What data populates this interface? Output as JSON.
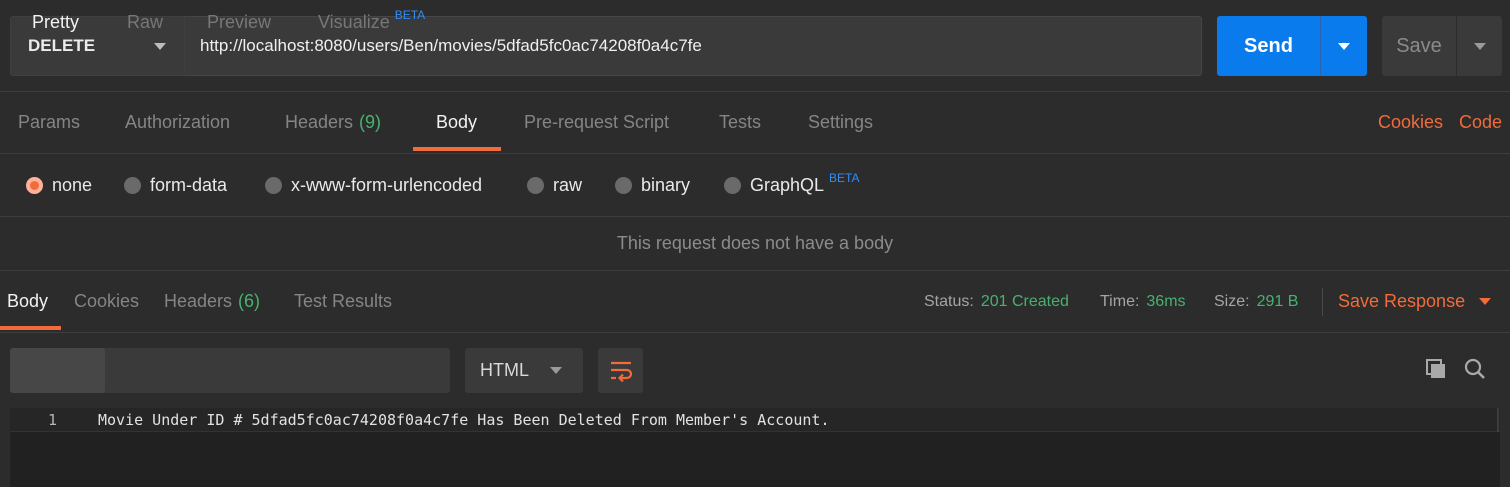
{
  "request": {
    "method": "DELETE",
    "url": "http://localhost:8080/users/Ben/movies/5dfad5fc0ac74208f0a4c7fe",
    "send_label": "Send",
    "save_label": "Save"
  },
  "request_tabs": {
    "params": "Params",
    "authorization": "Authorization",
    "headers": "Headers",
    "headers_count": "(9)",
    "body": "Body",
    "prerequest": "Pre-request Script",
    "tests": "Tests",
    "settings": "Settings",
    "cookies": "Cookies",
    "code": "Code"
  },
  "body_types": {
    "none": "none",
    "form_data": "form-data",
    "urlencoded": "x-www-form-urlencoded",
    "raw": "raw",
    "binary": "binary",
    "graphql": "GraphQL",
    "graphql_badge": "BETA",
    "selected": "none"
  },
  "no_body_message": "This request does not have a body",
  "response_tabs": {
    "body": "Body",
    "cookies": "Cookies",
    "headers": "Headers",
    "headers_count": "(6)",
    "test_results": "Test Results"
  },
  "response_meta": {
    "status_label": "Status:",
    "status_value": "201 Created",
    "time_label": "Time:",
    "time_value": "36ms",
    "size_label": "Size:",
    "size_value": "291 B",
    "save_response": "Save Response"
  },
  "view_modes": {
    "pretty": "Pretty",
    "raw": "Raw",
    "preview": "Preview",
    "visualize": "Visualize",
    "visualize_badge": "BETA",
    "format": "HTML"
  },
  "response_body": {
    "lines": [
      {
        "number": "1",
        "text": "Movie Under ID # 5dfad5fc0ac74208f0a4c7fe Has Been Deleted From Member's Account."
      }
    ]
  },
  "colors": {
    "accent": "#f26b3a",
    "send": "#097bed",
    "success": "#47b26f",
    "beta": "#2e8ef7"
  }
}
